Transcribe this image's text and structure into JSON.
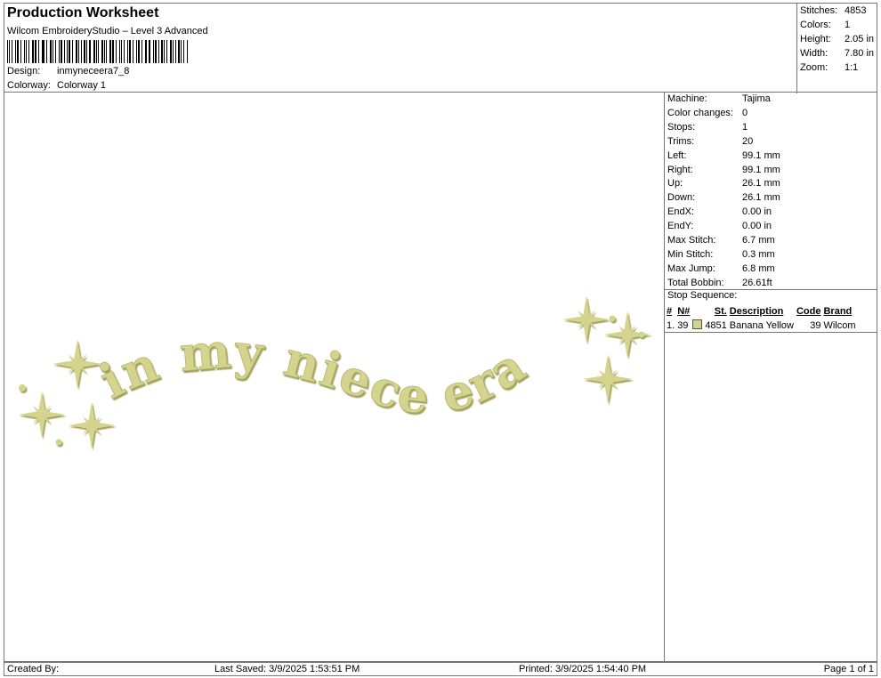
{
  "header": {
    "title": "Production Worksheet",
    "subtitle": "Wilcom EmbroideryStudio – Level 3 Advanced",
    "design_label": "Design:",
    "design_value": "inmyneceera7_8",
    "colorway_label": "Colorway:",
    "colorway_value": "Colorway 1"
  },
  "summary": {
    "stitches_label": "Stitches:",
    "stitches_value": "4853",
    "colors_label": "Colors:",
    "colors_value": "1",
    "height_label": "Height:",
    "height_value": "2.05 in",
    "width_label": "Width:",
    "width_value": "7.80 in",
    "zoom_label": "Zoom:",
    "zoom_value": "1:1"
  },
  "design": {
    "text": "in my niece era",
    "thread_color": "#d4d48e",
    "thread_shadow": "#9c9c52"
  },
  "properties": [
    {
      "label": "Machine:",
      "value": "Tajima"
    },
    {
      "label": "Color changes:",
      "value": "0"
    },
    {
      "label": "Stops:",
      "value": "1"
    },
    {
      "label": "Trims:",
      "value": "20"
    },
    {
      "label": "Left:",
      "value": "99.1 mm"
    },
    {
      "label": "Right:",
      "value": "99.1 mm"
    },
    {
      "label": "Up:",
      "value": "26.1 mm"
    },
    {
      "label": "Down:",
      "value": "26.1 mm"
    },
    {
      "label": "EndX:",
      "value": "0.00 in"
    },
    {
      "label": "EndY:",
      "value": "0.00 in"
    },
    {
      "label": "Max Stitch:",
      "value": "6.7 mm"
    },
    {
      "label": "Min Stitch:",
      "value": "0.3 mm"
    },
    {
      "label": "Max Jump:",
      "value": "6.8 mm"
    },
    {
      "label": "Total Bobbin:",
      "value": "26.61ft"
    }
  ],
  "stop_sequence": {
    "heading": "Stop Sequence:",
    "columns": [
      "#",
      "N#",
      "St.",
      "Description",
      "Code",
      "Brand"
    ],
    "rows": [
      {
        "index": "1.",
        "needle": "39",
        "swatch_color": "#d4d48e",
        "stitches": "4851",
        "description": "Banana Yellow",
        "code": "39",
        "brand": "Wilcom"
      }
    ]
  },
  "footer": {
    "created_by": "Created By:",
    "last_saved": "Last Saved: 3/9/2025 1:53:51 PM",
    "printed": "Printed: 3/9/2025 1:54:40 PM",
    "page": "Page 1 of 1"
  }
}
